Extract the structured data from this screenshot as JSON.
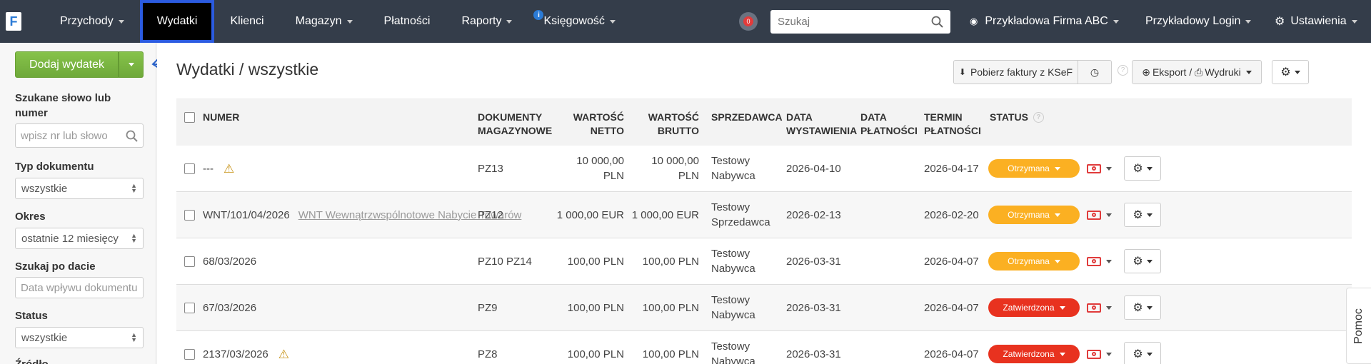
{
  "nav": {
    "logo": "F",
    "items": [
      {
        "label": "Przychody",
        "dropdown": true
      },
      {
        "label": "Wydatki",
        "dropdown": false,
        "active": true
      },
      {
        "label": "Klienci",
        "dropdown": false
      },
      {
        "label": "Magazyn",
        "dropdown": true
      },
      {
        "label": "Płatności",
        "dropdown": false
      },
      {
        "label": "Raporty",
        "dropdown": true
      },
      {
        "label": "Księgowość",
        "dropdown": true,
        "badge_icon": "info-icon"
      }
    ],
    "notifications_badge": "0",
    "search_placeholder": "Szukaj",
    "company": "Przykładowa Firma ABC",
    "login": "Przykładowy Login",
    "settings": "Ustawienia",
    "active_outline_color": "#2b5be0"
  },
  "sidebar": {
    "add_button": "Dodaj wydatek",
    "search_label": "Szukane słowo lub numer",
    "search_placeholder": "wpisz nr lub słowo",
    "doc_type_label": "Typ dokumentu",
    "doc_type_value": "wszystkie",
    "period_label": "Okres",
    "period_value": "ostatnie 12 miesięcy",
    "date_search_label": "Szukaj po dacie",
    "date_search_placeholder": "Data wpływu dokumentu",
    "status_label": "Status",
    "status_value": "wszystkie",
    "source_label": "Źródło"
  },
  "main": {
    "title": "Wydatki / wszystkie",
    "ksef_button": "Pobierz faktury z KSeF",
    "export_button": "Eksport / ",
    "print_button": "Wydruki",
    "columns": {
      "number": "Numer",
      "docs": [
        "Dokumenty",
        "magazynowe"
      ],
      "net": [
        "Wartość",
        "netto"
      ],
      "gross": [
        "Wartość",
        "brutto"
      ],
      "seller": "Sprzedawca",
      "issue_date": [
        "Data",
        "wystawienia"
      ],
      "pay_date": [
        "Data",
        "płatności"
      ],
      "due_date": [
        "Termin",
        "płatności"
      ],
      "status": "Status"
    },
    "rows": [
      {
        "number": "---",
        "warn": true,
        "link": "",
        "docs": "PZ13",
        "net": "10 000,00 PLN",
        "gross": "10 000,00 PLN",
        "seller": [
          "Testowy",
          "Nabywca"
        ],
        "issue": "2026-04-10",
        "paid": "",
        "due": "2026-04-17",
        "status": "Otrzymana",
        "status_color": "#fbb022"
      },
      {
        "number": "WNT/101/04/2026",
        "warn": false,
        "link": "WNT Wewnątrzwspólnotowe Nabycie Towarów",
        "docs": "PZ12",
        "net": "1 000,00 EUR",
        "gross": "1 000,00 EUR",
        "seller": [
          "Testowy",
          "Sprzedawca"
        ],
        "issue": "2026-02-13",
        "paid": "",
        "due": "2026-02-20",
        "status": "Otrzymana",
        "status_color": "#fbb022"
      },
      {
        "number": "68/03/2026",
        "warn": false,
        "link": "",
        "docs": "PZ10 PZ14",
        "net": "100,00 PLN",
        "gross": "100,00 PLN",
        "seller": [
          "Testowy",
          "Nabywca"
        ],
        "issue": "2026-03-31",
        "paid": "",
        "due": "2026-04-07",
        "status": "Otrzymana",
        "status_color": "#fbb022"
      },
      {
        "number": "67/03/2026",
        "warn": false,
        "link": "",
        "docs": "PZ9",
        "net": "100,00 PLN",
        "gross": "100,00 PLN",
        "seller": [
          "Testowy",
          "Nabywca"
        ],
        "issue": "2026-03-31",
        "paid": "",
        "due": "2026-04-07",
        "status": "Zatwierdzona",
        "status_color": "#e8321f"
      },
      {
        "number": "2137/03/2026",
        "warn": true,
        "link": "",
        "docs": "PZ8",
        "net": "100,00 PLN",
        "gross": "100,00 PLN",
        "seller": [
          "Testowy",
          "Nabywca"
        ],
        "issue": "2026-03-31",
        "paid": "",
        "due": "2026-04-07",
        "status": "Zatwierdzona",
        "status_color": "#e8321f"
      }
    ]
  },
  "help_tab": "Pomoc"
}
